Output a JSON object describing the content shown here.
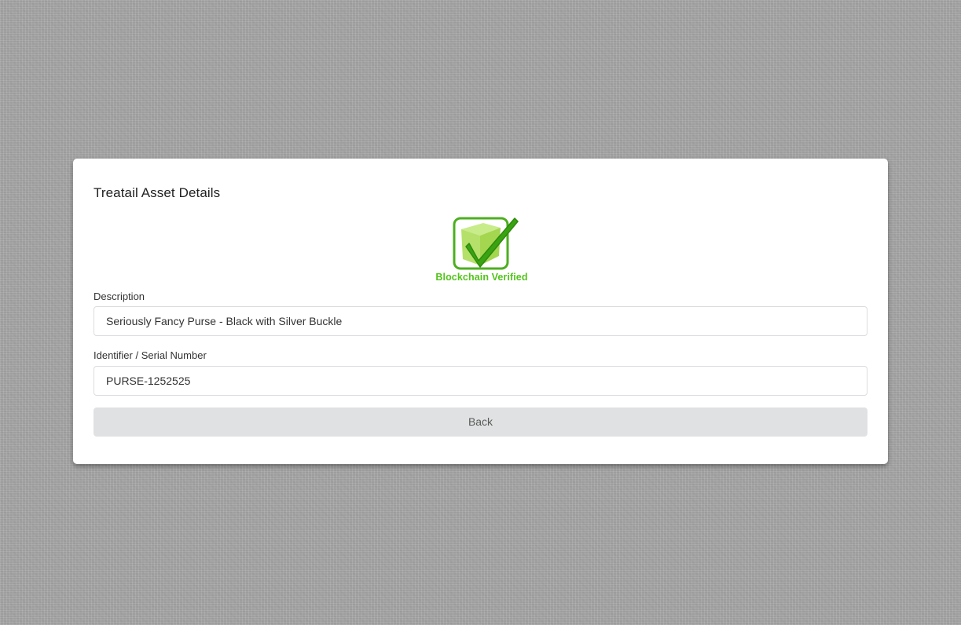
{
  "card": {
    "title": "Treatail Asset Details"
  },
  "logo": {
    "text": "Blockchain Verified",
    "icon": "blockchain-verified-check-icon",
    "color": "#52c41a"
  },
  "fields": {
    "description": {
      "label": "Description",
      "value": "Seriously Fancy Purse - Black with Silver Buckle"
    },
    "identifier": {
      "label": "Identifier / Serial Number",
      "value": "PURSE-1252525"
    }
  },
  "actions": {
    "back_label": "Back"
  }
}
